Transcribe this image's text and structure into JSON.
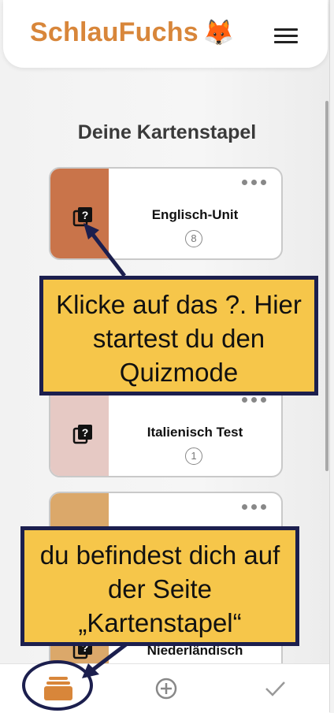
{
  "app": {
    "title": "SchlauFuchs",
    "logo_emoji": "🦊"
  },
  "page": {
    "heading": "Deine Kartenstapel"
  },
  "decks": [
    {
      "name": "Englisch-Unit",
      "count": "8",
      "color": "#c9744a"
    },
    {
      "name": "Italienisch Test",
      "count": "1",
      "color": "#e6c9c4"
    },
    {
      "name": "Niederländisch",
      "count": "",
      "color": "#dba86a"
    }
  ],
  "callouts": {
    "quiz": "Klicke auf das ?. Hier startest du den Quizmode",
    "page": "du befindest dich auf der Seite „Kartenstapel“"
  },
  "nav": {
    "items": [
      "stack-icon",
      "add-circle-icon",
      "check-icon"
    ],
    "active_color": "#d8863a"
  },
  "colors": {
    "brand": "#d8863a",
    "callout_bg": "#f6c64a",
    "callout_border": "#1c1f4e"
  }
}
